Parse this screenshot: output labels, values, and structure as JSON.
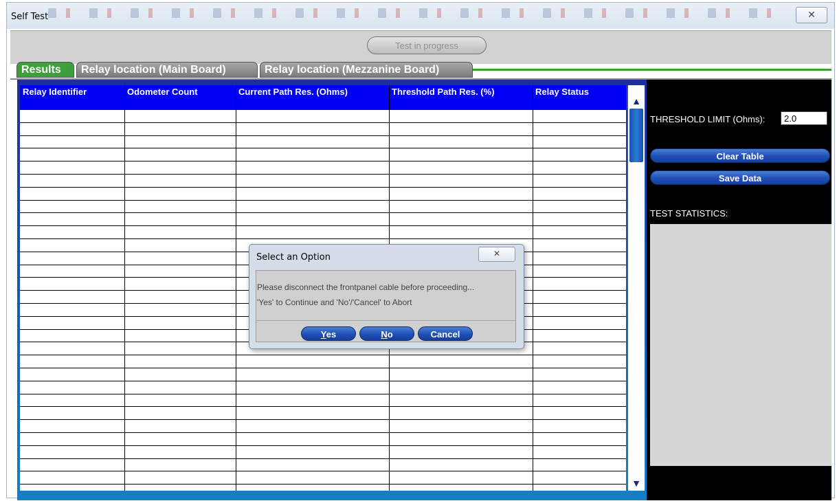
{
  "window": {
    "title": "Self Test",
    "close_glyph": "✕"
  },
  "toolbar": {
    "progress_label": "Test in progress"
  },
  "tabs": [
    {
      "label": "Results",
      "active": true
    },
    {
      "label": "Relay location (Main Board)",
      "active": false
    },
    {
      "label": "Relay location (Mezzanine Board)",
      "active": false
    }
  ],
  "table": {
    "columns": [
      "Relay Identifier",
      "Odometer Count",
      "Current Path Res. (Ohms)",
      "Threshold Path Res. (%)",
      "Relay Status"
    ],
    "rows": []
  },
  "scrollbar": {
    "up_glyph": "▲",
    "down_glyph": "▼"
  },
  "side_panel": {
    "threshold_label": "THRESHOLD LIMIT (Ohms):",
    "threshold_value": "2.0",
    "clear_button": "Clear Table",
    "save_button": "Save Data",
    "stats_label": "TEST STATISTICS:"
  },
  "dialog": {
    "title": "Select an Option",
    "close_glyph": "✕",
    "message_line1": "Please disconnect the frontpanel cable before proceeding...",
    "message_line2": "'Yes' to Continue and 'No'/'Cancel' to Abort",
    "yes_mnemonic": "Y",
    "yes_rest": "es",
    "no_mnemonic": "N",
    "no_rest": "o",
    "cancel_label": "Cancel"
  },
  "colors": {
    "table_header": "#0000f4",
    "active_tab": "#3ea03a",
    "button_blue": "#1f4fb6",
    "side_panel_bg": "#000000"
  }
}
